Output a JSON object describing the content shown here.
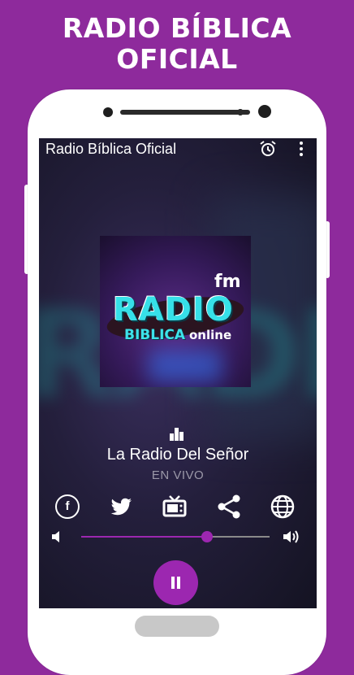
{
  "promo": {
    "line1": "RADIO BÍBLICA",
    "line2": "OFICIAL"
  },
  "appbar": {
    "title": "Radio Bíblica Oficial",
    "alarm_icon": "alarm-icon",
    "more_icon": "more-vert-icon"
  },
  "artwork": {
    "fm": "fm",
    "radio": "RADIO",
    "biblica": "BIBLICA",
    "online": "online"
  },
  "player": {
    "station": "La Radio Del Señor",
    "status": "EN VIVO",
    "volume": 0.67
  },
  "social": {
    "facebook_glyph": "f",
    "icons": [
      "facebook-icon",
      "twitter-icon",
      "tv-icon",
      "share-icon",
      "globe-icon"
    ]
  },
  "colors": {
    "background": "#8e2a9c",
    "accent": "#9c27b0",
    "status_text": "#9b98a8"
  }
}
